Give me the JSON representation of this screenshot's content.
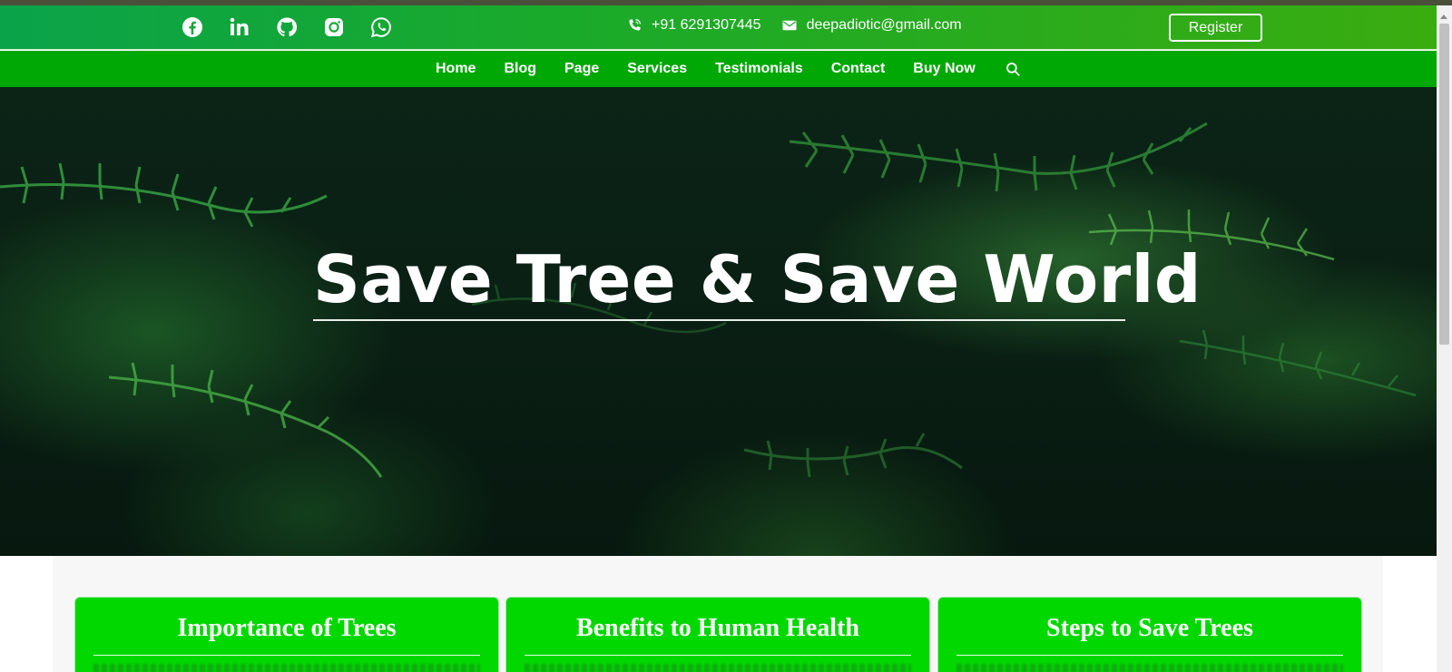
{
  "topbar": {
    "social_icons": [
      "facebook-icon",
      "linkedin-icon",
      "github-icon",
      "instagram-icon",
      "whatsapp-icon"
    ],
    "phone": "+91 6291307445",
    "email": "deepadiotic@gmail.com",
    "register_label": "Register"
  },
  "nav": {
    "items": [
      "Home",
      "Blog",
      "Page",
      "Services",
      "Testimonials",
      "Contact",
      "Buy Now"
    ],
    "search_icon": "search-icon"
  },
  "hero": {
    "title": "Save Tree & Save World"
  },
  "cards": [
    {
      "title": "Importance of Trees"
    },
    {
      "title": "Benefits to Human Health"
    },
    {
      "title": "Steps to Save Trees"
    }
  ],
  "colors": {
    "topbar_start": "#0aa34a",
    "topbar_end": "#3aac10",
    "nav_bg": "#00a805",
    "card_bg": "#00d800",
    "hero_dark": "#0a1f14"
  }
}
